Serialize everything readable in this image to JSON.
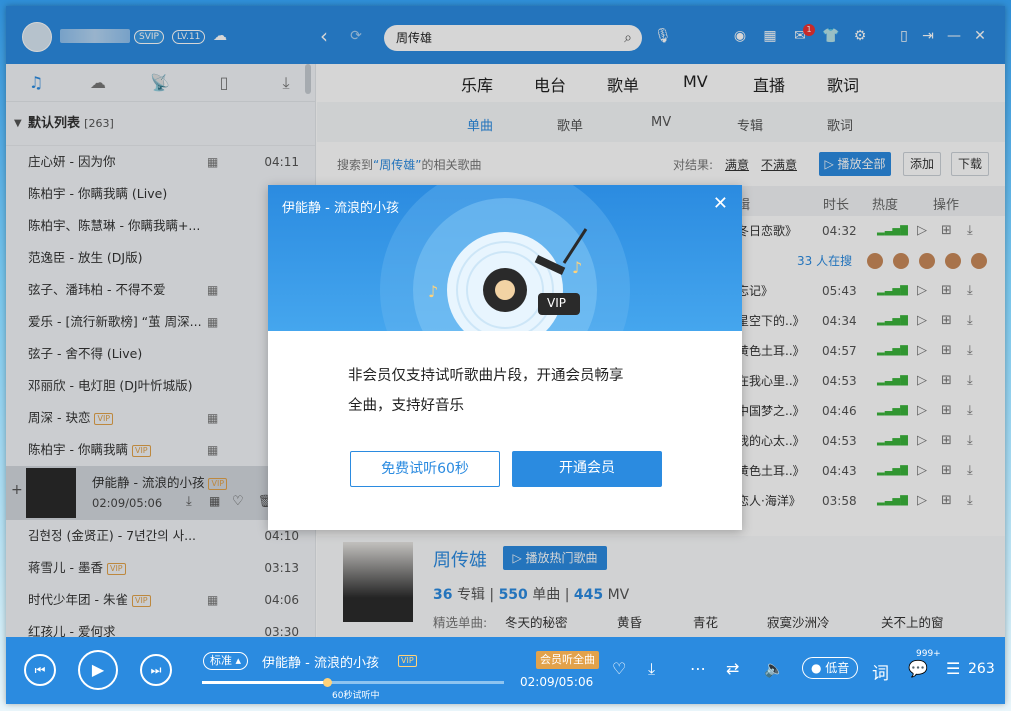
{
  "colors": {
    "brand": "#2b8be0",
    "vip": "#e2a24b",
    "mail_badge": "#e53333"
  },
  "header": {
    "svip": "SVIP",
    "level": "LV.11",
    "search_value": "周传雄",
    "mail_count": "1"
  },
  "sidebar": {
    "tabs": [
      "music-icon",
      "cloud-icon",
      "radio-icon",
      "device-icon",
      "download-icon"
    ],
    "list_title": "默认列表",
    "list_count": "[263]",
    "songs": [
      {
        "title": "庄心妍 - 因为你",
        "dur": "04:11"
      },
      {
        "title": "陈柏宇 - 你瞒我瞒 (Live)",
        "dur": ""
      },
      {
        "title": "陈柏宇、陈慧琳 - 你瞒我瞒+...",
        "dur": ""
      },
      {
        "title": "范逸臣 - 放生 (DJ版)",
        "dur": ""
      },
      {
        "title": "弦子、潘玮柏 - 不得不爱",
        "dur": ""
      },
      {
        "title": "爱乐 - [流行新歌榜] “茧 周深...",
        "dur": ""
      },
      {
        "title": "弦子 - 舍不得 (Live)",
        "dur": ""
      },
      {
        "title": "邓丽欣 - 电灯胆 (DJ叶忻城版)",
        "dur": ""
      },
      {
        "title": "周深 - 玦恋",
        "dur": ""
      },
      {
        "title": "陈柏宇 - 你瞒我瞒",
        "dur": ""
      }
    ],
    "vip_label": "VIP",
    "now_playing": {
      "title": "伊能静 - 流浪的小孩",
      "time": "02:09/05:06"
    },
    "songs_after": [
      {
        "title": "김현정 (金贤正) - 7년간의 사...",
        "dur": "04:10"
      },
      {
        "title": "蒋雪儿 - 墨香",
        "dur": "03:13"
      },
      {
        "title": "时代少年团 - 朱雀",
        "dur": "04:06"
      },
      {
        "title": "红孩儿 - 爱何求",
        "dur": "03:30"
      }
    ]
  },
  "main": {
    "tabs": [
      "乐库",
      "电台",
      "歌单",
      "MV",
      "直播",
      "歌词"
    ],
    "subtabs": [
      "单曲",
      "歌单",
      "MV",
      "专辑",
      "歌词"
    ],
    "result_prefix": "搜索到",
    "result_keyword": "“周传雄”",
    "result_suffix": "的相关歌曲",
    "feedback_label": "对结果:",
    "satisfied": "满意",
    "unsatisfied": "不满意",
    "play_all": "播放全部",
    "add": "添加",
    "download": "下载",
    "columns": [
      "辑",
      "时长",
      "热度",
      "操作"
    ],
    "rows": [
      {
        "album": "冬日恋歌》",
        "dur": "04:32"
      },
      {
        "album": "",
        "dur": "",
        "searching": "33 人在搜"
      },
      {
        "album": "忘记》",
        "dur": "05:43"
      },
      {
        "album": "星空下的..》",
        "dur": "04:34"
      },
      {
        "album": "黄色土耳..》",
        "dur": "04:57"
      },
      {
        "album": "在我心里..》",
        "dur": "04:53"
      },
      {
        "album": "中国梦之..》",
        "dur": "04:46"
      },
      {
        "album": "我的心太..》",
        "dur": "04:53"
      },
      {
        "album": "黄色土耳..》",
        "dur": "04:43"
      },
      {
        "album": "恋人·海洋》",
        "dur": "03:58"
      }
    ],
    "artist": {
      "name": "周传雄",
      "play_hot": "播放热门歌曲",
      "albums": "36",
      "albums_label": "专辑",
      "singles": "550",
      "singles_label": "单曲",
      "mvs": "445",
      "mv_label": "MV",
      "featured_label": "精选单曲:",
      "featured": [
        "冬天的秘密",
        "黄昏",
        "青花",
        "寂寞沙洲冷",
        "关不上的窗"
      ]
    }
  },
  "modal": {
    "title": "伊能静 - 流浪的小孩",
    "vip_badge": "VIP",
    "message_line1": "非会员仅支持试听歌曲片段，开通会员畅享",
    "message_line2": "全曲，支持好音乐",
    "trial_button": "免费试听60秒",
    "vip_button": "开通会员"
  },
  "player": {
    "quality": "标准",
    "title": "伊能静 - 流浪的小孩",
    "vip_label": "VIP",
    "full_song": "会员听全曲",
    "time": "02:09/05:06",
    "trial_hint": "60秒试听中",
    "low_quality": "低音",
    "lyrics": "词",
    "comment_count": "999+",
    "playlist_count": "263",
    "progress": 0.42
  }
}
